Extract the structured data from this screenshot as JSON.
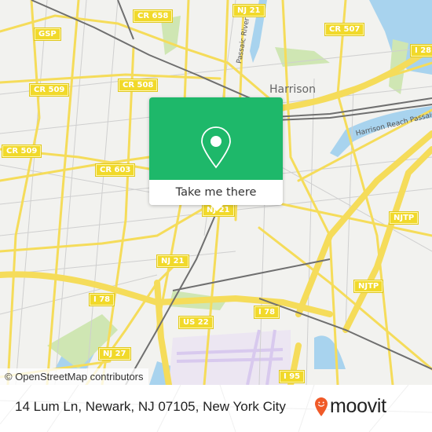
{
  "map": {
    "road_labels": [
      {
        "id": "cr658",
        "text": "CR 658"
      },
      {
        "id": "nj21-top",
        "text": "NJ 21"
      },
      {
        "id": "cr507",
        "text": "CR 507"
      },
      {
        "id": "i280",
        "text": "I 28"
      },
      {
        "id": "gsp",
        "text": "GSP"
      },
      {
        "id": "cr509-a",
        "text": "CR 509"
      },
      {
        "id": "cr508",
        "text": "CR 508"
      },
      {
        "id": "cr509-b",
        "text": "CR 509"
      },
      {
        "id": "cr603",
        "text": "CR 603"
      },
      {
        "id": "nj21-mid",
        "text": "NJ 21"
      },
      {
        "id": "nj21-low",
        "text": "NJ 21"
      },
      {
        "id": "njtp-a",
        "text": "NJTP"
      },
      {
        "id": "njtp-b",
        "text": "NJTP"
      },
      {
        "id": "i78-a",
        "text": "I 78"
      },
      {
        "id": "i78-b",
        "text": "I 78"
      },
      {
        "id": "us22",
        "text": "US 22"
      },
      {
        "id": "nj27",
        "text": "NJ 27"
      },
      {
        "id": "i95",
        "text": "I 95"
      }
    ],
    "place_labels": {
      "harrison": "Harrison",
      "passaic_river": "Passaic River",
      "harrison_reach": "Harrison Reach Passaic River"
    },
    "attribution": "© OpenStreetMap contributors"
  },
  "popup": {
    "icon": "map-pin-icon",
    "action_label": "Take me there",
    "color": "#1eb86a"
  },
  "footer": {
    "address": "14 Lum Ln, Newark, NJ 07105, New York City",
    "brand": "moovit",
    "brand_color": "#f05a28"
  }
}
